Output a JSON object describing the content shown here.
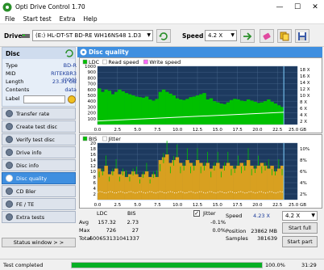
{
  "window": {
    "title": "Opti Drive Control 1.70",
    "minimize": "—",
    "maximize": "☐",
    "close": "✕"
  },
  "menu": [
    "File",
    "Start test",
    "Extra",
    "Help"
  ],
  "toolbar": {
    "drive_label": "Drive",
    "drive_value": "(E:)  HL-DT-ST BD-RE  WH16NS48 1.D3",
    "speed_label": "Speed",
    "speed_value": "4.2 X"
  },
  "disc": {
    "header": "Disc",
    "fields": [
      {
        "k": "Type",
        "v": "BD-R"
      },
      {
        "k": "MID",
        "v": "RITEKBR3 (000)"
      },
      {
        "k": "Length",
        "v": "23.31 GB"
      },
      {
        "k": "Contents",
        "v": "data"
      },
      {
        "k": "Label",
        "v": ""
      }
    ]
  },
  "nav": [
    "Transfer rate",
    "Create test disc",
    "Verify test disc",
    "Drive info",
    "Disc info",
    "Disc quality",
    "CD Bler",
    "FE / TE",
    "Extra tests"
  ],
  "nav_active_index": 5,
  "status_window_label": "Status window > >",
  "panel_title": "Disc quality",
  "chart_data": [
    {
      "type": "area",
      "legend": [
        "LDC",
        "Read speed",
        "Write speed"
      ],
      "legend_colors": [
        "#00c000",
        "#ffffff",
        "#ff66ff"
      ],
      "x_ticks": [
        "0.0",
        "2.5",
        "5.0",
        "7.5",
        "10.0",
        "12.5",
        "15.0",
        "17.5",
        "20.0",
        "22.5",
        "25.0 GB"
      ],
      "y_left_ticks": [
        "1000",
        "900",
        "800",
        "700",
        "600",
        "500",
        "400",
        "300",
        "200",
        "100"
      ],
      "y_right_ticks": [
        "18 X",
        "16 X",
        "14 X",
        "12 X",
        "10 X",
        "8 X",
        "6 X",
        "4 X",
        "2 X"
      ],
      "xlim": [
        0,
        25
      ],
      "ylim": [
        0,
        1000
      ],
      "ldc_profile": [
        620,
        560,
        600,
        580,
        520,
        560,
        600,
        570,
        540,
        520,
        500,
        480,
        470,
        460,
        480,
        430,
        410,
        440,
        560,
        600,
        560,
        530,
        500,
        450,
        430,
        420,
        440,
        470,
        480,
        500,
        520,
        540,
        430,
        450,
        400,
        380,
        360,
        350,
        380,
        420,
        440,
        430,
        410,
        400,
        430,
        410,
        390,
        370,
        380,
        400,
        430,
        390,
        360,
        330,
        300
      ],
      "read_speed": [
        1.2,
        4.2
      ]
    },
    {
      "type": "area",
      "legend": [
        "BIS",
        "Jitter"
      ],
      "legend_colors": [
        "#00c000",
        "#ffffff"
      ],
      "x_ticks": [
        "0.0",
        "2.5",
        "5.0",
        "7.5",
        "10.0",
        "12.5",
        "15.0",
        "17.5",
        "20.0",
        "22.5",
        "25.0 GB"
      ],
      "y_left_ticks": [
        "20",
        "18",
        "16",
        "14",
        "12",
        "10",
        "8",
        "6",
        "4",
        "2"
      ],
      "y_right_ticks": [
        "10%",
        "8%",
        "6%",
        "4%",
        "2%"
      ],
      "xlim": [
        0,
        25
      ],
      "ylim": [
        0,
        20
      ],
      "bis_profile": [
        11,
        10,
        12,
        9,
        10,
        11,
        9,
        10,
        8,
        9,
        10,
        9,
        8,
        9,
        10,
        8,
        9,
        8,
        14,
        15,
        16,
        13,
        14,
        15,
        13,
        12,
        14,
        13,
        12,
        14,
        13,
        12,
        13,
        11,
        12,
        13,
        11,
        12,
        13,
        12,
        11,
        12,
        13,
        12,
        14,
        12,
        11,
        12,
        13,
        12,
        11,
        12,
        10,
        11,
        12
      ]
    }
  ],
  "stats": {
    "headers": [
      "LDC",
      "BIS"
    ],
    "rows": [
      {
        "label": "Avg",
        "ldc": "157.32",
        "bis": "2.73"
      },
      {
        "label": "Max",
        "ldc": "726",
        "bis": "27"
      },
      {
        "label": "Total",
        "ldc": "60065313",
        "bis": "1041337"
      }
    ],
    "jitter_label": "Jitter",
    "jitter_avg": "-0.1%",
    "jitter_max": "0.0%",
    "speed_label": "Speed",
    "speed_value": "4.23 X",
    "speed_select": "4.2 X",
    "position_label": "Position",
    "position_value": "23862 MB",
    "samples_label": "Samples",
    "samples_value": "381639",
    "start_full": "Start full",
    "start_part": "Start part"
  },
  "statusbar": {
    "text": "Test completed",
    "progress_text": "100.0%",
    "progress": 1.0,
    "time": "31:29"
  }
}
